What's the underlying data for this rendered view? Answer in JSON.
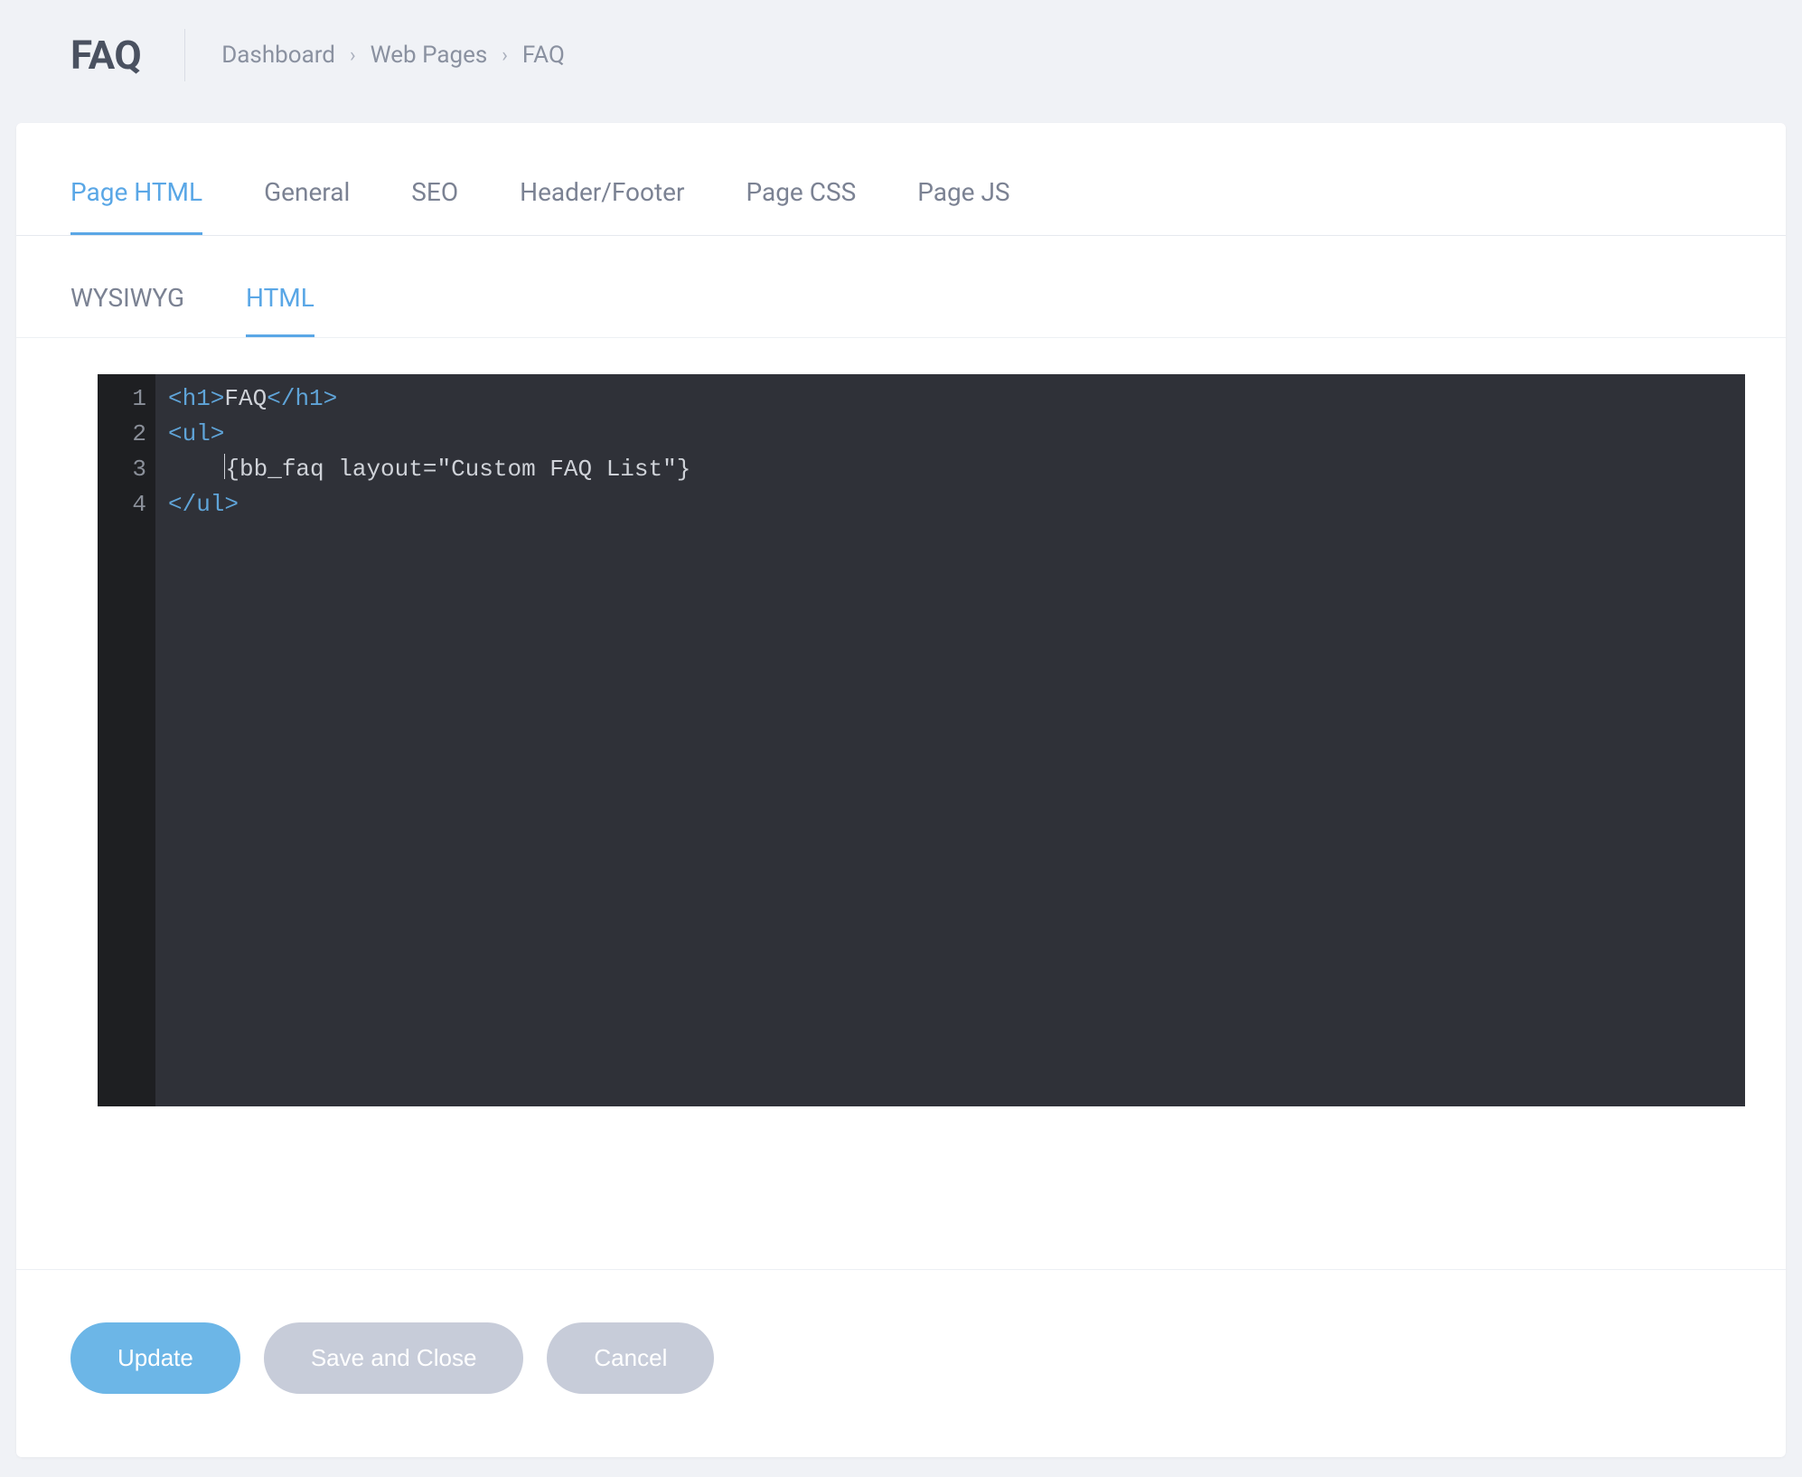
{
  "header": {
    "title": "FAQ",
    "breadcrumb": [
      "Dashboard",
      "Web Pages",
      "FAQ"
    ]
  },
  "tabs": {
    "primary": [
      {
        "label": "Page HTML",
        "active": true
      },
      {
        "label": "General",
        "active": false
      },
      {
        "label": "SEO",
        "active": false
      },
      {
        "label": "Header/Footer",
        "active": false
      },
      {
        "label": "Page CSS",
        "active": false
      },
      {
        "label": "Page JS",
        "active": false
      }
    ],
    "secondary": [
      {
        "label": "WYSIWYG",
        "active": false
      },
      {
        "label": "HTML",
        "active": true
      }
    ]
  },
  "editor": {
    "line_numbers": [
      "1",
      "2",
      "3",
      "4"
    ],
    "code_lines": [
      {
        "segments": [
          {
            "cls": "tag",
            "t": "<h1>"
          },
          {
            "cls": "txt",
            "t": "FAQ"
          },
          {
            "cls": "tag",
            "t": "</h1>"
          }
        ]
      },
      {
        "segments": [
          {
            "cls": "tag",
            "t": "<ul>"
          }
        ]
      },
      {
        "indent": "    ",
        "cursor": true,
        "segments": [
          {
            "cls": "brace",
            "t": "{bb_faq layout=\"Custom FAQ List\"}"
          }
        ]
      },
      {
        "segments": [
          {
            "cls": "tag",
            "t": "</ul>"
          }
        ]
      }
    ]
  },
  "actions": {
    "update": "Update",
    "save_close": "Save and Close",
    "cancel": "Cancel"
  }
}
